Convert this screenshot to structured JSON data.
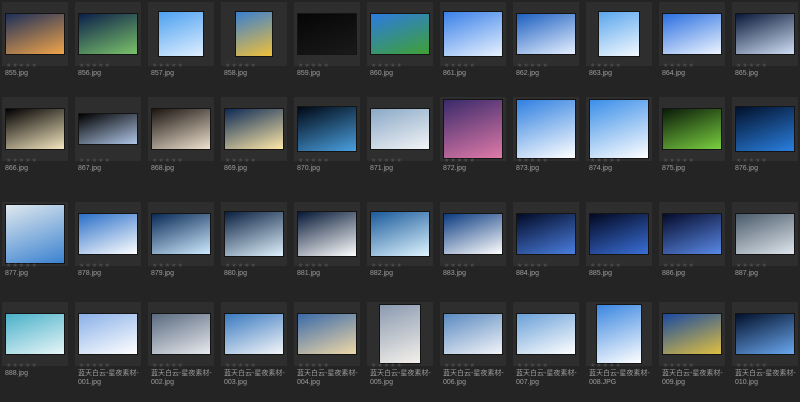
{
  "window": {
    "title": ""
  },
  "thumbnails": [
    {
      "name": "855.jpg",
      "rating": "★★★★★",
      "thumb_icon": "sky-sunset-thumbnail",
      "colors": [
        "#1d2f5a",
        "#f2a54a"
      ]
    },
    {
      "name": "856.jpg",
      "rating": "★★★★★",
      "thumb_icon": "rainbow-earth-thumbnail",
      "colors": [
        "#0c1f4a",
        "#7bc36a"
      ]
    },
    {
      "name": "857.jpg",
      "rating": "★★★★★",
      "thumb_icon": "sky-tree-thumbnail",
      "colors": [
        "#4da0f0",
        "#dfefff"
      ]
    },
    {
      "name": "858.jpg",
      "rating": "★★★★★",
      "thumb_icon": "hot-air-balloon-thumbnail",
      "colors": [
        "#3a7fd0",
        "#f0c03a"
      ]
    },
    {
      "name": "859.jpg",
      "rating": "★★★★★",
      "thumb_icon": "lightning-dark-thumbnail",
      "colors": [
        "#050505",
        "#1a1a1a"
      ]
    },
    {
      "name": "860.jpg",
      "rating": "★★★★★",
      "thumb_icon": "sky-grass-thumbnail",
      "colors": [
        "#2d7be0",
        "#3fa035"
      ]
    },
    {
      "name": "861.jpg",
      "rating": "★★★★★",
      "thumb_icon": "rainbow-sky-thumbnail",
      "colors": [
        "#3a80e8",
        "#e8f2ff"
      ]
    },
    {
      "name": "862.jpg",
      "rating": "★★★★★",
      "thumb_icon": "blue-sky-clouds-thumbnail",
      "colors": [
        "#1d5fc0",
        "#e6f0ff"
      ]
    },
    {
      "name": "863.jpg",
      "rating": "★★★★★",
      "thumb_icon": "blue-sky-clouds-thumbnail",
      "colors": [
        "#5aa6ec",
        "#f4f9ff"
      ]
    },
    {
      "name": "864.jpg",
      "rating": "★★★★★",
      "thumb_icon": "blue-sky-clouds-thumbnail",
      "colors": [
        "#2a6fe0",
        "#eef5ff"
      ]
    },
    {
      "name": "865.jpg",
      "rating": "★★★★★",
      "thumb_icon": "night-clouds-thumbnail",
      "colors": [
        "#0a1838",
        "#d0dff5"
      ]
    },
    {
      "name": "866.jpg",
      "rating": "★★★★★",
      "thumb_icon": "full-moon-thumbnail",
      "colors": [
        "#000000",
        "#f5e7c0"
      ]
    },
    {
      "name": "867.jpg",
      "rating": "★★★★★",
      "thumb_icon": "moon-reflection-thumbnail",
      "colors": [
        "#000000",
        "#b0c7e8"
      ]
    },
    {
      "name": "868.jpg",
      "rating": "★★★★★",
      "thumb_icon": "light-burst-thumbnail",
      "colors": [
        "#1a1410",
        "#f0e2d0"
      ]
    },
    {
      "name": "869.jpg",
      "rating": "★★★★★",
      "thumb_icon": "crescent-moon-thumbnail",
      "colors": [
        "#0d2a55",
        "#ffe9a8"
      ]
    },
    {
      "name": "870.jpg",
      "rating": "★★★★★",
      "thumb_icon": "earth-horizon-thumbnail",
      "colors": [
        "#000814",
        "#4aa0e0"
      ]
    },
    {
      "name": "871.jpg",
      "rating": "★★★★★",
      "thumb_icon": "cloudy-sky-thumbnail",
      "colors": [
        "#8aa8c6",
        "#f2f4f6"
      ]
    },
    {
      "name": "872.jpg",
      "rating": "★★★★★",
      "thumb_icon": "purple-clouds-thumbnail",
      "colors": [
        "#3a2a6a",
        "#e07aa8"
      ]
    },
    {
      "name": "873.jpg",
      "rating": "★★★★★",
      "thumb_icon": "cloud-ring-thumbnail",
      "colors": [
        "#2f7fe0",
        "#ffffff"
      ]
    },
    {
      "name": "874.jpg",
      "rating": "★★★★★",
      "thumb_icon": "blue-sky-clouds-thumbnail",
      "colors": [
        "#3a8ee8",
        "#ffffff"
      ]
    },
    {
      "name": "875.jpg",
      "rating": "★★★★★",
      "thumb_icon": "green-nebula-thumbnail",
      "colors": [
        "#0a1a08",
        "#7ad040"
      ]
    },
    {
      "name": "876.jpg",
      "rating": "★★★★★",
      "thumb_icon": "blue-nebula-thumbnail",
      "colors": [
        "#02102a",
        "#2a80e0"
      ]
    },
    {
      "name": "877.jpg",
      "rating": "★★★★★",
      "thumb_icon": "window-frame-thumbnail",
      "colors": [
        "#dfe8ee",
        "#3b82d0"
      ]
    },
    {
      "name": "878.jpg",
      "rating": "★★★★★",
      "thumb_icon": "blue-sky-clouds-thumbnail",
      "colors": [
        "#2a6fc8",
        "#ffffff"
      ]
    },
    {
      "name": "879.jpg",
      "rating": "★★★★★",
      "thumb_icon": "lightning-blue-thumbnail",
      "colors": [
        "#082a55",
        "#cfeaff"
      ]
    },
    {
      "name": "880.jpg",
      "rating": "★★★★★",
      "thumb_icon": "lightning-blue-thumbnail",
      "colors": [
        "#0a2040",
        "#dff2ff"
      ]
    },
    {
      "name": "881.jpg",
      "rating": "★★★★★",
      "thumb_icon": "lightning-blue-thumbnail",
      "colors": [
        "#051836",
        "#ffffff"
      ]
    },
    {
      "name": "882.jpg",
      "rating": "★★★★★",
      "thumb_icon": "lightning-blue-thumbnail",
      "colors": [
        "#1a5a9a",
        "#dff5ff"
      ]
    },
    {
      "name": "883.jpg",
      "rating": "★★★★★",
      "thumb_icon": "single-cloud-thumbnail",
      "colors": [
        "#0a3a80",
        "#ffffff"
      ]
    },
    {
      "name": "884.jpg",
      "rating": "★★★★★",
      "thumb_icon": "starfield-thumbnail",
      "colors": [
        "#020a26",
        "#4a7fe0"
      ]
    },
    {
      "name": "885.jpg",
      "rating": "★★★★★",
      "thumb_icon": "starfield-thumbnail",
      "colors": [
        "#020820",
        "#3a6fd8"
      ]
    },
    {
      "name": "886.jpg",
      "rating": "★★★★★",
      "thumb_icon": "starfield-thumbnail",
      "colors": [
        "#050a2a",
        "#5a8ae8"
      ]
    },
    {
      "name": "887.jpg",
      "rating": "★★★★★",
      "thumb_icon": "storm-clouds-thumbnail",
      "colors": [
        "#4a5a6a",
        "#dfe6ec"
      ]
    },
    {
      "name": "888.jpg",
      "rating": "★★★★★",
      "thumb_icon": "teal-sky-thumbnail",
      "colors": [
        "#4ab0c8",
        "#e8f6f8"
      ]
    },
    {
      "name": "蓝天白云-星夜素材-001.jpg",
      "rating": "★★★★★",
      "thumb_icon": "bright-clouds-thumbnail",
      "colors": [
        "#8ab0e8",
        "#ffffff"
      ]
    },
    {
      "name": "蓝天白云-星夜素材-002.jpg",
      "rating": "★★★★★",
      "thumb_icon": "volcano-clouds-thumbnail",
      "colors": [
        "#5a6a80",
        "#e8eaee"
      ]
    },
    {
      "name": "蓝天白云-星夜素材-003.jpg",
      "rating": "★★★★★",
      "thumb_icon": "cloud-sea-thumbnail",
      "colors": [
        "#3a7ac0",
        "#f4f6f8"
      ]
    },
    {
      "name": "蓝天白云-星夜素材-004.jpg",
      "rating": "★★★★★",
      "thumb_icon": "cloud-sea-sunset-thumbnail",
      "colors": [
        "#3a6aa8",
        "#f0d8a8"
      ]
    },
    {
      "name": "蓝天白云-星夜素材-005.jpg",
      "rating": "★★★★★",
      "thumb_icon": "cloud-tower-thumbnail",
      "colors": [
        "#8a9ab0",
        "#f4f0ea"
      ]
    },
    {
      "name": "蓝天白云-星夜素材-006.jpg",
      "rating": "★★★★★",
      "thumb_icon": "cloud-sea-thumbnail",
      "colors": [
        "#5a8ac0",
        "#f2f4f8"
      ]
    },
    {
      "name": "蓝天白云-星夜素材-007.jpg",
      "rating": "★★★★★",
      "thumb_icon": "cloud-sea-thumbnail",
      "colors": [
        "#6aa0d8",
        "#ffffff"
      ]
    },
    {
      "name": "蓝天白云-星夜素材-008.JPG",
      "rating": "★★★★★",
      "thumb_icon": "blue-sky-clouds-thumbnail",
      "colors": [
        "#3a86e0",
        "#ffffff"
      ]
    },
    {
      "name": "蓝天白云-星夜素材-009.jpg",
      "rating": "★★★★★",
      "thumb_icon": "sky-field-thumbnail",
      "colors": [
        "#1a4aa0",
        "#e0c040"
      ]
    },
    {
      "name": "蓝天白云-星夜素材-010.jpg",
      "rating": "★★★★★",
      "thumb_icon": "blue-planet-horizon-thumbnail",
      "colors": [
        "#02102a",
        "#6aa8f0"
      ]
    }
  ]
}
